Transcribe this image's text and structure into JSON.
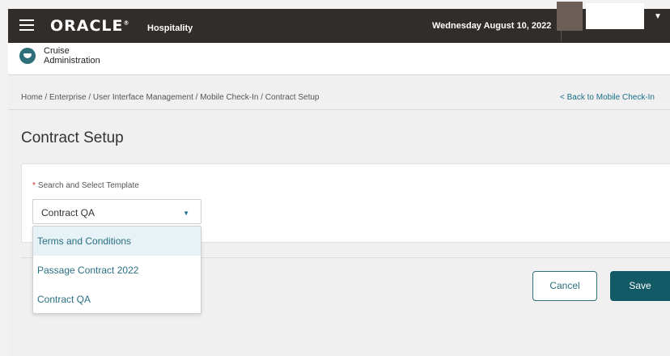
{
  "topbar": {
    "brand": "ORACLE",
    "registered": "®",
    "product": "Hospitality",
    "date": "Wednesday August 10, 2022",
    "colors": {
      "background": "#312d2a",
      "avatar": "#6b5f57"
    }
  },
  "app": {
    "title_line1": "Cruise",
    "title_line2": "Administration",
    "icon": "cruise-ship-icon"
  },
  "breadcrumb": "Home / Enterprise / User Interface Management / Mobile Check-In / Contract Setup",
  "back_link": "< Back to Mobile Check-In",
  "page_title": "Contract Setup",
  "form": {
    "required_marker": "*",
    "label": "Search and Select Template",
    "selected_value": "Contract QA",
    "options": [
      "Terms and Conditions",
      "Passage Contract 2022",
      "Contract QA"
    ],
    "highlighted_option": "Terms and Conditions"
  },
  "buttons": {
    "cancel": "Cancel",
    "save": "Save"
  },
  "colors": {
    "accent": "#125a66",
    "link": "#1a6f8a",
    "required": "#c9302c"
  }
}
